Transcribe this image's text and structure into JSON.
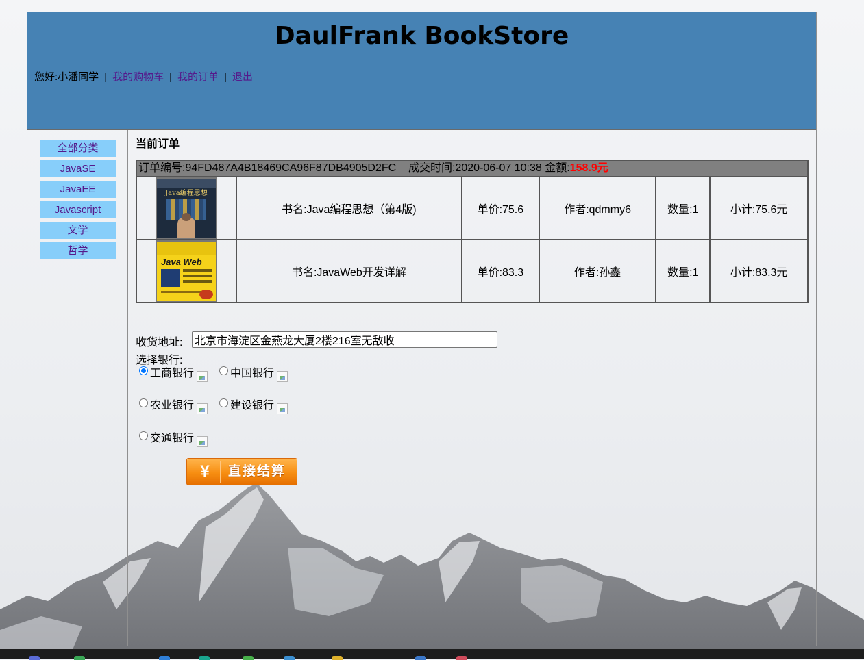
{
  "header": {
    "title": "DaulFrank BookStore",
    "greeting_prefix": "您好:",
    "username": "小潘同学",
    "separator": "|",
    "links": [
      "我的购物车",
      "我的订单",
      "退出"
    ]
  },
  "sidebar": {
    "categories": [
      "全部分类",
      "JavaSE",
      "JavaEE",
      "Javascript",
      "文学",
      "哲学"
    ]
  },
  "order": {
    "section_title": "当前订单",
    "number_label": "订单编号:",
    "number": "94FD487A4B18469CA96F87DB4905D2FC",
    "time_label": "成交时间:",
    "time": "2020-06-07 10:38",
    "amount_label": "金额:",
    "amount": "158.9元",
    "items": [
      {
        "cover_text": "Java编程思想",
        "name": "书名:Java编程思想（第4版)",
        "price": "单价:75.6",
        "author": "作者:qdmmy6",
        "quantity": "数量:1",
        "subtotal": "小计:75.6元"
      },
      {
        "cover_text": "Java Web",
        "name": "书名:JavaWeb开发详解",
        "price": "单价:83.3",
        "author": "作者:孙鑫",
        "quantity": "数量:1",
        "subtotal": "小计:83.3元"
      }
    ]
  },
  "form": {
    "address_label": "收货地址:",
    "address_value": "北京市海淀区金燕龙大厦2楼216室无敌收",
    "bank_label": "选择银行:",
    "banks": [
      "工商银行",
      "中国银行",
      "农业银行",
      "建设银行",
      "交通银行"
    ],
    "selected_bank": "工商银行",
    "pay_symbol": "¥",
    "pay_button": "直接结算"
  },
  "colors": {
    "header_bg": "#4682b4",
    "category_bg": "#87cefa",
    "order_head_bg": "#808080",
    "amount_color": "#ff0000",
    "pay_button": "#f78e12"
  }
}
